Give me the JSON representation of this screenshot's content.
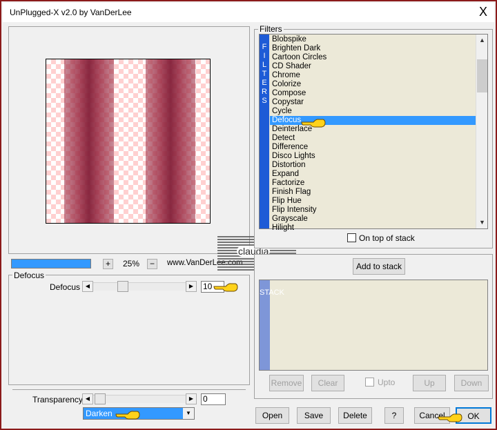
{
  "window": {
    "title": "UnPlugged-X v2.0 by VanDerLee",
    "close": "X"
  },
  "filters": {
    "group_label": "Filters",
    "side_label": [
      "F",
      "I",
      "L",
      "T",
      "E",
      "R",
      "S"
    ],
    "items": [
      "Blobspike",
      "Brighten Dark",
      "Cartoon Circles",
      "CD Shader",
      "Chrome",
      "Colorize",
      "Compose",
      "Copystar",
      "Cycle",
      "Defocus",
      "Deinterlace",
      "Detect",
      "Difference",
      "Disco Lights",
      "Distortion",
      "Expand",
      "Factorize",
      "Finish Flag",
      "Flip Hue",
      "Flip Intensity",
      "Grayscale",
      "Hilight"
    ],
    "selected": "Defocus",
    "on_top_label": "On top of stack",
    "on_top_checked": false
  },
  "zoom": {
    "plus": "+",
    "value": "25%",
    "minus": "−",
    "website": "www.VanDerLee.com"
  },
  "stack": {
    "add_label": "Add to stack",
    "side_label": [
      "S",
      "T",
      "A",
      "C",
      "K"
    ],
    "remove": "Remove",
    "clear": "Clear",
    "upto": "Upto",
    "up": "Up",
    "down": "Down"
  },
  "params": {
    "group_label": "Defocus",
    "defocus_label": "Defocus",
    "defocus_value": "10",
    "defocus_level": 0.3
  },
  "blend": {
    "transparency_label": "Transparency",
    "transparency_value": "0",
    "mode": "Darken"
  },
  "footer": {
    "open": "Open",
    "save": "Save",
    "delete": "Delete",
    "help": "?",
    "cancel": "Cancel",
    "ok": "OK"
  },
  "watermark": {
    "text": "claudia"
  },
  "colors": {
    "selection": "#3399ff",
    "side_label": "#1e5bd6",
    "preview_stripe": "#9b2c44",
    "checker": "#ffd0d0"
  }
}
